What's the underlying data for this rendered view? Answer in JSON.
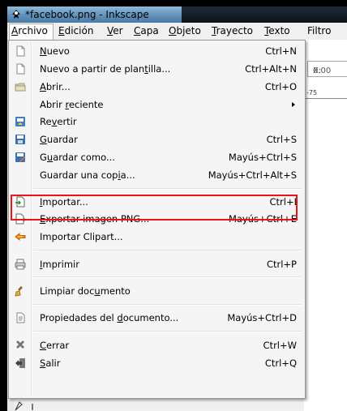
{
  "window": {
    "title": "*facebook.png - Inkscape"
  },
  "menubar": {
    "items": [
      {
        "label": "Archivo",
        "mnemonic": "A",
        "rest": "rchivo"
      },
      {
        "label": "Edición",
        "mnemonic": "E",
        "rest": "dición"
      },
      {
        "label": "Ver",
        "mnemonic": "V",
        "rest": "er"
      },
      {
        "label": "Capa",
        "mnemonic": "C",
        "rest": "apa"
      },
      {
        "label": "Objeto",
        "mnemonic": "O",
        "rest": "bjeto"
      },
      {
        "label": "Trayecto",
        "mnemonic": "T",
        "rest": "rayecto"
      },
      {
        "label": "Texto",
        "mnemonic": "T",
        "rest": "exto"
      },
      {
        "label": "Filtros",
        "mnemonic": "",
        "rest": "Filtro"
      }
    ]
  },
  "toolbar": {
    "x_label": "X:",
    "x_value": "0.00"
  },
  "ruler": {
    "tick_label": "-75"
  },
  "file_menu": {
    "items": [
      {
        "label": "Nuevo",
        "pre": "",
        "u": "N",
        "post": "uevo",
        "shortcut": "Ctrl+N",
        "icon": "new-document-icon"
      },
      {
        "label": "Nuevo a partir de plantilla...",
        "pre": "Nuevo a partir de plan",
        "u": "t",
        "post": "illa...",
        "shortcut": "Ctrl+Alt+N",
        "icon": "template-icon"
      },
      {
        "label": "Abrir...",
        "pre": "",
        "u": "A",
        "post": "brir...",
        "shortcut": "Ctrl+O",
        "icon": "open-folder-icon"
      },
      {
        "label": "Abrir reciente",
        "pre": "Abrir ",
        "u": "r",
        "post": "eciente",
        "shortcut": "",
        "icon": "",
        "submenu": true
      },
      {
        "label": "Revertir",
        "pre": "Re",
        "u": "v",
        "post": "ertir",
        "shortcut": "",
        "icon": "revert-icon"
      },
      {
        "label": "Guardar",
        "pre": "",
        "u": "G",
        "post": "uardar",
        "shortcut": "Ctrl+S",
        "icon": "save-icon"
      },
      {
        "label": "Guardar como...",
        "pre": "G",
        "u": "u",
        "post": "ardar como...",
        "shortcut": "Mayús+Ctrl+S",
        "icon": "save-as-icon"
      },
      {
        "label": "Guardar una copia...",
        "pre": "Guardar una cop",
        "u": "i",
        "post": "a...",
        "shortcut": "Mayús+Ctrl+Alt+S",
        "icon": ""
      },
      {
        "label": "Importar...",
        "pre": "",
        "u": "I",
        "post": "mportar...",
        "shortcut": "Ctrl+I",
        "icon": "import-icon"
      },
      {
        "label": "Exportar imagen PNG...",
        "pre": "",
        "u": "E",
        "post": "xportar imagen PNG...",
        "shortcut": "Mayús+Ctrl+E",
        "icon": "export-icon"
      },
      {
        "label": "Importar Clipart...",
        "pre": "Importar Clipart...",
        "u": "",
        "post": "",
        "shortcut": "",
        "icon": "clipart-icon"
      },
      {
        "label": "Imprimir",
        "pre": "",
        "u": "I",
        "post": "mprimir",
        "shortcut": "Ctrl+P",
        "icon": "print-icon"
      },
      {
        "label": "Limpiar documento",
        "pre": "Limpiar doc",
        "u": "u",
        "post": "mento",
        "shortcut": "",
        "icon": "clean-icon"
      },
      {
        "label": "Propiedades del documento...",
        "pre": "Propiedades del ",
        "u": "d",
        "post": "ocumento...",
        "shortcut": "Mayús+Ctrl+D",
        "icon": "properties-icon"
      },
      {
        "label": "Cerrar",
        "pre": "",
        "u": "C",
        "post": "errar",
        "shortcut": "Ctrl+W",
        "icon": "close-icon"
      },
      {
        "label": "Salir",
        "pre": "",
        "u": "S",
        "post": "alir",
        "shortcut": "Ctrl+Q",
        "icon": "quit-icon"
      }
    ]
  },
  "annotation": {
    "highlighted_item": "Importar...",
    "color": "#e8141c"
  }
}
